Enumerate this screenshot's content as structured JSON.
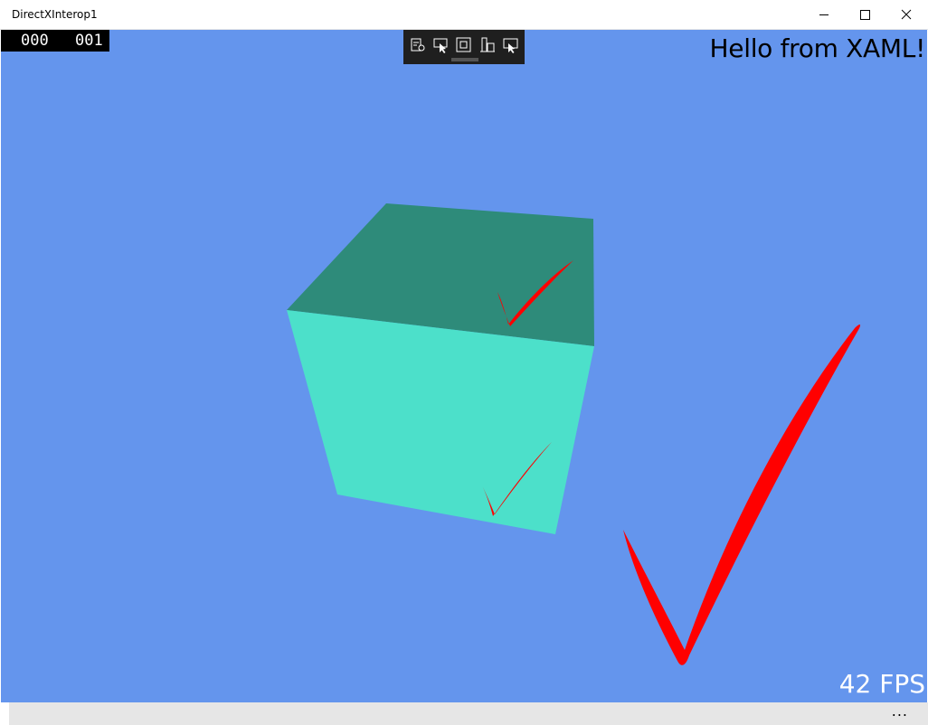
{
  "window": {
    "title": "DirectXInterop1"
  },
  "caption_buttons": {
    "minimize": "minimize-icon",
    "maximize": "maximize-icon",
    "close": "close-icon"
  },
  "frame_counter": {
    "left": "000",
    "right": "001"
  },
  "debug_toolbar": {
    "buttons": [
      "live-visual-tree-icon",
      "select-element-icon",
      "display-layout-adorners-icon",
      "track-focus-icon",
      "hot-reload-icon"
    ]
  },
  "overlay": {
    "hello_text": "Hello from XAML!",
    "fps_text": "42 FPS"
  },
  "appbar": {
    "more_label": "..."
  },
  "colors": {
    "background": "#6495ED",
    "cube_top": "#2E8B7A",
    "cube_front": "#4CE0CA",
    "ink": "#FF0000"
  }
}
